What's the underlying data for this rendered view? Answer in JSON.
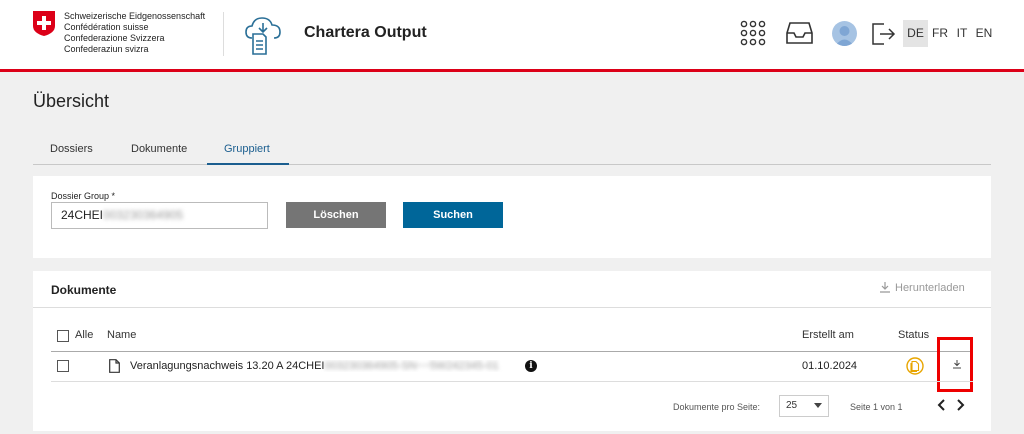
{
  "header": {
    "confederation_lines": [
      "Schweizerische Eidgenossenschaft",
      "Confédération suisse",
      "Confederazione Svizzera",
      "Confederaziun svizra"
    ],
    "app_title": "Chartera Output",
    "icons": [
      "swiss-flag",
      "cloud-document-icon",
      "apps-grid-icon",
      "inbox-icon",
      "user-avatar",
      "logout-icon"
    ],
    "languages": [
      "DE",
      "FR",
      "IT",
      "EN"
    ],
    "active_language": "DE",
    "accent_color": "#dc0018"
  },
  "page": {
    "title": "Übersicht",
    "tabs": [
      "Dossiers",
      "Dokumente",
      "Gruppiert"
    ],
    "active_tab": "Gruppiert"
  },
  "search": {
    "field_label": "Dossier Group *",
    "field_value_visible": "24CHEI",
    "field_value_redacted": "003230364905",
    "clear_label": "Löschen",
    "search_label": "Suchen",
    "primary_color": "#006699"
  },
  "documents": {
    "title": "Dokumente",
    "download_all_label": "Herunterladen",
    "select_all_label": "Alle",
    "columns": [
      "Name",
      "Erstellt am",
      "Status"
    ],
    "rows": [
      {
        "name_visible": "Veranlagungsnachweis 13.20 A 24CHEI",
        "name_redacted": "003230364905-SN~~5W242345-01",
        "created": "01.10.2024",
        "status_icon": "document-status-icon",
        "action_icon": "download-icon"
      }
    ],
    "pager": {
      "per_page_label": "Dokumente pro Seite:",
      "per_page_value": "25",
      "page_info": "Seite 1 von 1"
    }
  }
}
